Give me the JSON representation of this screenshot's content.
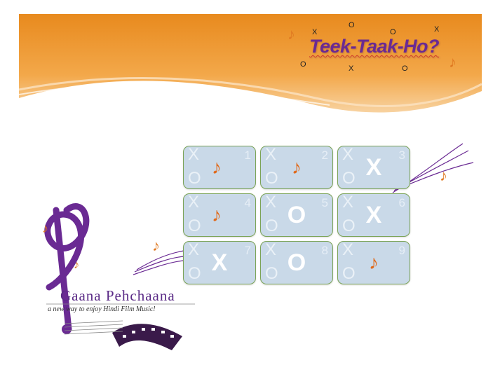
{
  "title": "Teek-Taak-Ho?",
  "scatter_marks": [
    "X",
    "O",
    "O",
    "X",
    "O",
    "X",
    "O"
  ],
  "cell_watermark": {
    "x": "X",
    "o": "O"
  },
  "board": {
    "cells": [
      {
        "number": "1",
        "mark": "♪"
      },
      {
        "number": "2",
        "mark": "♪"
      },
      {
        "number": "3",
        "mark": "X"
      },
      {
        "number": "4",
        "mark": "♪"
      },
      {
        "number": "5",
        "mark": "O"
      },
      {
        "number": "6",
        "mark": "X"
      },
      {
        "number": "7",
        "mark": "X"
      },
      {
        "number": "8",
        "mark": "O"
      },
      {
        "number": "9",
        "mark": "♪"
      }
    ]
  },
  "logo": {
    "name": "Gaana Pehchaana",
    "tagline": "a new way to enjoy Hindi Film Music!"
  },
  "colors": {
    "accent": "#6a2a93",
    "banner": "#f09a30",
    "cell": "#c9d9e8",
    "note": "#e07a22"
  },
  "icons": [
    "music-note-icon",
    "treble-clef-icon",
    "film-strip-icon"
  ]
}
